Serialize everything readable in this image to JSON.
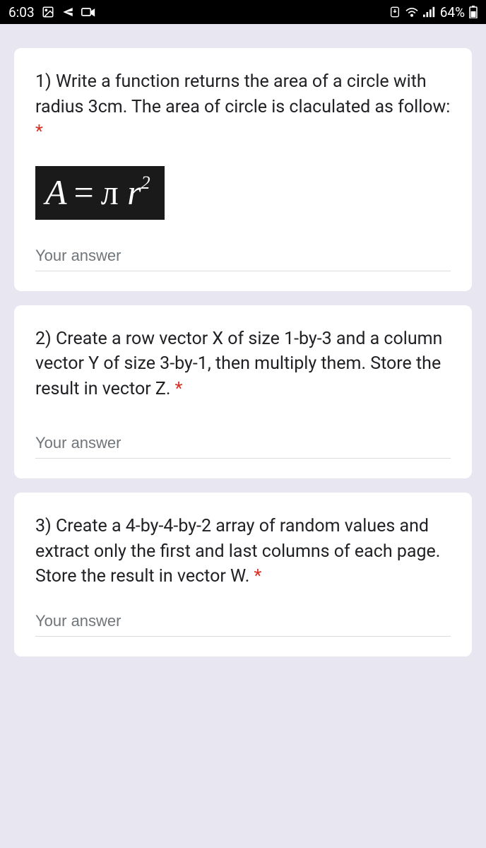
{
  "status": {
    "time": "6:03",
    "battery_text": "64%"
  },
  "questions": [
    {
      "text": "1) Write a function returns the area of a circle with radius 3cm. The area of circle is claculated as follow: ",
      "required": "*",
      "placeholder": "Your answer"
    },
    {
      "text": "2) Create a row vector X of size 1-by-3 and a column vector Y of size 3-by-1, then multiply them. Store the result in vector Z. ",
      "required": "*",
      "placeholder": "Your answer"
    },
    {
      "text": "3) Create a 4-by-4-by-2 array of random values and extract only the first and last columns of each page. Store the result in vector W. ",
      "required": "*",
      "placeholder": "Your answer"
    }
  ]
}
